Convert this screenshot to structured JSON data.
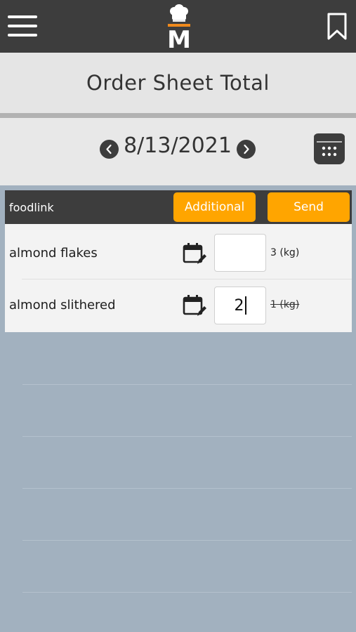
{
  "header": {
    "menu_icon": "hamburger-menu-icon",
    "logo_letter": "M",
    "bookmark_icon": "bookmark-icon"
  },
  "page": {
    "title": "Order Sheet Total"
  },
  "date_nav": {
    "date": "8/13/2021",
    "prev_icon": "chevron-left-icon",
    "next_icon": "chevron-right-icon",
    "calendar_icon": "calendar-icon"
  },
  "supplier": {
    "name": "foodlink",
    "additional_label": "Additional",
    "send_label": "Send"
  },
  "items": [
    {
      "name": "almond flakes",
      "qty": "",
      "stock": "3 (kg)",
      "stock_struck": false
    },
    {
      "name": "almond slithered",
      "qty": "2",
      "stock": "1 (kg)",
      "stock_struck": true
    }
  ],
  "colors": {
    "bar": "#3d3d3d",
    "accent": "#ffa500",
    "background": "#a2b1bf"
  }
}
